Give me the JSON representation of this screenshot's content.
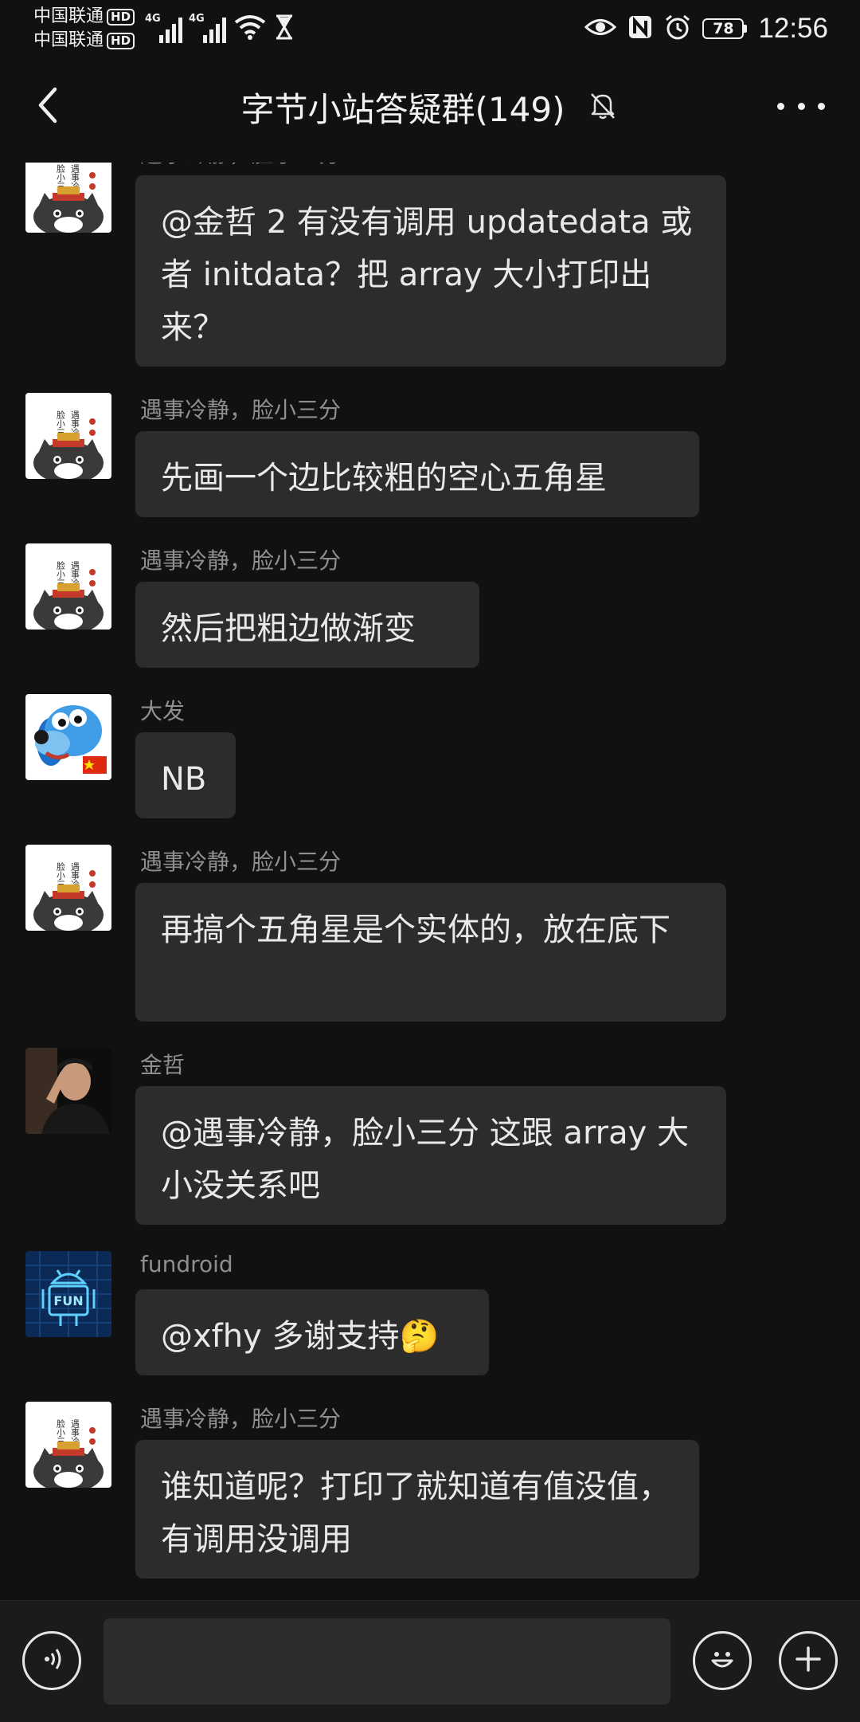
{
  "status_bar": {
    "carrier_1": "中国联通",
    "carrier_2": "中国联通",
    "hd_badge": "HD",
    "network_1": "4G",
    "network_2": "4G",
    "battery": "78",
    "time": "12:56"
  },
  "header": {
    "title": "字节小站答疑群(149)",
    "icons": [
      "back-arrow-icon",
      "bell-muted-icon",
      "more-icon"
    ]
  },
  "messages": [
    {
      "sender": "遇事冷静，脸小三分",
      "text": "@金哲  2 有没有调用 updatedata 或者 initdata？把 array 大小打印出来？",
      "avatar": "cat-avatar"
    },
    {
      "sender": "遇事冷静，脸小三分",
      "text": "先画一个边比较粗的空心五角星",
      "avatar": "cat-avatar"
    },
    {
      "sender": "遇事冷静，脸小三分",
      "text": "然后把粗边做渐变",
      "avatar": "cat-avatar"
    },
    {
      "sender": "大发",
      "text": "NB",
      "avatar": "dog-avatar"
    },
    {
      "sender": "遇事冷静，脸小三分",
      "text": "再搞个五角星是个实体的，放在底下",
      "avatar": "cat-avatar"
    },
    {
      "sender": "金哲",
      "text": "@遇事冷静，脸小三分  这跟 array 大小没关系吧",
      "avatar": "photo-avatar"
    },
    {
      "sender": "fundroid",
      "text": "@xfhy 多谢支持🤔",
      "avatar": "android-avatar"
    },
    {
      "sender": "遇事冷静，脸小三分",
      "text": "谁知道呢？打印了就知道有值没值，有调用没调用",
      "avatar": "cat-avatar"
    }
  ],
  "input_bar": {
    "placeholder": "",
    "icons": [
      "voice-icon",
      "emoji-icon",
      "plus-icon"
    ]
  },
  "colors": {
    "background": "#111111",
    "bubble": "#2c2c2c",
    "sender_text": "#8f8f8f",
    "message_text": "#e9e9e9"
  }
}
